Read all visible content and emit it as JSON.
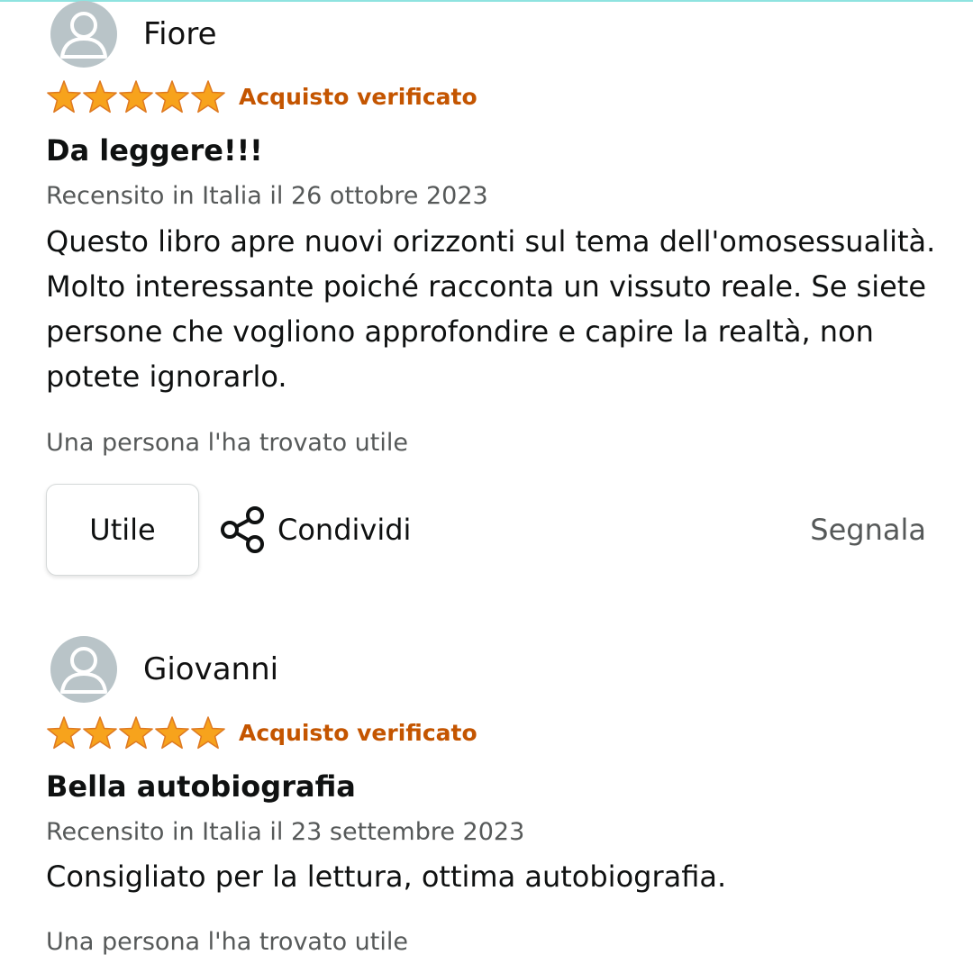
{
  "reviews": [
    {
      "reviewer": "Fiore",
      "rating": 5,
      "verified": "Acquisto verificato",
      "title": "Da leggere!!!",
      "date": "Recensito in Italia il 26 ottobre 2023",
      "body": "Questo libro apre nuovi orizzonti sul tema dell'omosessualità. Molto interessante poiché racconta un vissuto reale. Se siete persone che vogliono approfondire e capire la realtà, non potete ignorarlo.",
      "helpful_count": "Una persona l'ha trovato utile",
      "helpful_label": "Utile",
      "share_label": "Condividi",
      "report_label": "Segnala"
    },
    {
      "reviewer": "Giovanni",
      "rating": 5,
      "verified": "Acquisto verificato",
      "title": "Bella autobiografia",
      "date": "Recensito in Italia il 23 settembre 2023",
      "body": "Consigliato per la lettura, ottima autobiografia.",
      "helpful_count": "Una persona l'ha trovato utile"
    }
  ],
  "colors": {
    "star": "#f7a31c",
    "verified": "#c45500",
    "avatar_bg": "#b9c4c8",
    "muted_text": "#565959",
    "accent_line": "#8fe3e0"
  },
  "icons": {
    "avatar": "person-icon",
    "star": "star-icon",
    "share": "share-icon"
  }
}
